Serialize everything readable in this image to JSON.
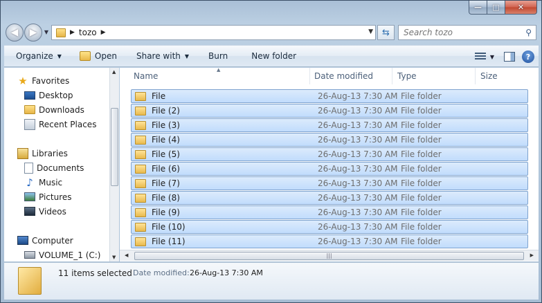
{
  "window": {
    "caption_minimize": "—",
    "caption_maximize": "□",
    "caption_close": "✕"
  },
  "nav_buttons": {
    "back_glyph": "◀",
    "forward_glyph": "▶"
  },
  "address_bar": {
    "crumb": "tozo"
  },
  "search": {
    "placeholder": "Search tozo"
  },
  "command_bar": {
    "organize": "Organize",
    "open": "Open",
    "share_with": "Share with",
    "burn": "Burn",
    "new_folder": "New folder",
    "help": "?"
  },
  "nav_pane": {
    "favorites": "Favorites",
    "desktop": "Desktop",
    "downloads": "Downloads",
    "recent_places": "Recent Places",
    "libraries": "Libraries",
    "documents": "Documents",
    "music": "Music",
    "pictures": "Pictures",
    "videos": "Videos",
    "computer": "Computer",
    "volume": "VOLUME_1 (C:)"
  },
  "columns": {
    "name": "Name",
    "date_modified": "Date modified",
    "type": "Type",
    "size": "Size"
  },
  "files": [
    {
      "name": "File",
      "date": "26-Aug-13 7:30 AM",
      "type": "File folder"
    },
    {
      "name": "File (2)",
      "date": "26-Aug-13 7:30 AM",
      "type": "File folder"
    },
    {
      "name": "File (3)",
      "date": "26-Aug-13 7:30 AM",
      "type": "File folder"
    },
    {
      "name": "File (4)",
      "date": "26-Aug-13 7:30 AM",
      "type": "File folder"
    },
    {
      "name": "File (5)",
      "date": "26-Aug-13 7:30 AM",
      "type": "File folder"
    },
    {
      "name": "File (6)",
      "date": "26-Aug-13 7:30 AM",
      "type": "File folder"
    },
    {
      "name": "File (7)",
      "date": "26-Aug-13 7:30 AM",
      "type": "File folder"
    },
    {
      "name": "File (8)",
      "date": "26-Aug-13 7:30 AM",
      "type": "File folder"
    },
    {
      "name": "File (9)",
      "date": "26-Aug-13 7:30 AM",
      "type": "File folder"
    },
    {
      "name": "File (10)",
      "date": "26-Aug-13 7:30 AM",
      "type": "File folder"
    },
    {
      "name": "File (11)",
      "date": "26-Aug-13 7:30 AM",
      "type": "File folder"
    }
  ],
  "details_pane": {
    "selected": "11 items selected",
    "date_label": "Date modified:",
    "date_value": "26-Aug-13 7:30 AM"
  },
  "colors": {
    "selection": "#c1dcfc",
    "selection_border": "#7da2ce",
    "accent": "#2f6fb0"
  }
}
